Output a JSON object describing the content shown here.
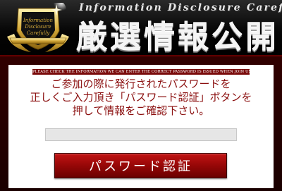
{
  "header": {
    "subtitle": "Information Disclosure Carefully",
    "title": "厳選情報公開",
    "logo": {
      "icon": "gold-crest-emblem-icon",
      "text_line1": "Information",
      "text_line2": "Disclosure",
      "text_line3": "Carefully"
    }
  },
  "notice": {
    "text": "PLEASE CHECK THE INFORMATION WE CAN ENTER THE CORRECT PASSWORD IS ISSUED WHEN JOIN US"
  },
  "message": {
    "lines": [
      "ご参加の際に発行されたパスワードを",
      "正しくご入力頂き「パスワード認証」ボタンを",
      "押して情報をご確認下さい。"
    ]
  },
  "form": {
    "password_value": "",
    "password_placeholder": "",
    "submit_label": "パスワード認証"
  },
  "colors": {
    "background": "#1a0000",
    "accent": "#8b0f0f",
    "button": "#9a0808",
    "gold": "#d4a93a"
  }
}
